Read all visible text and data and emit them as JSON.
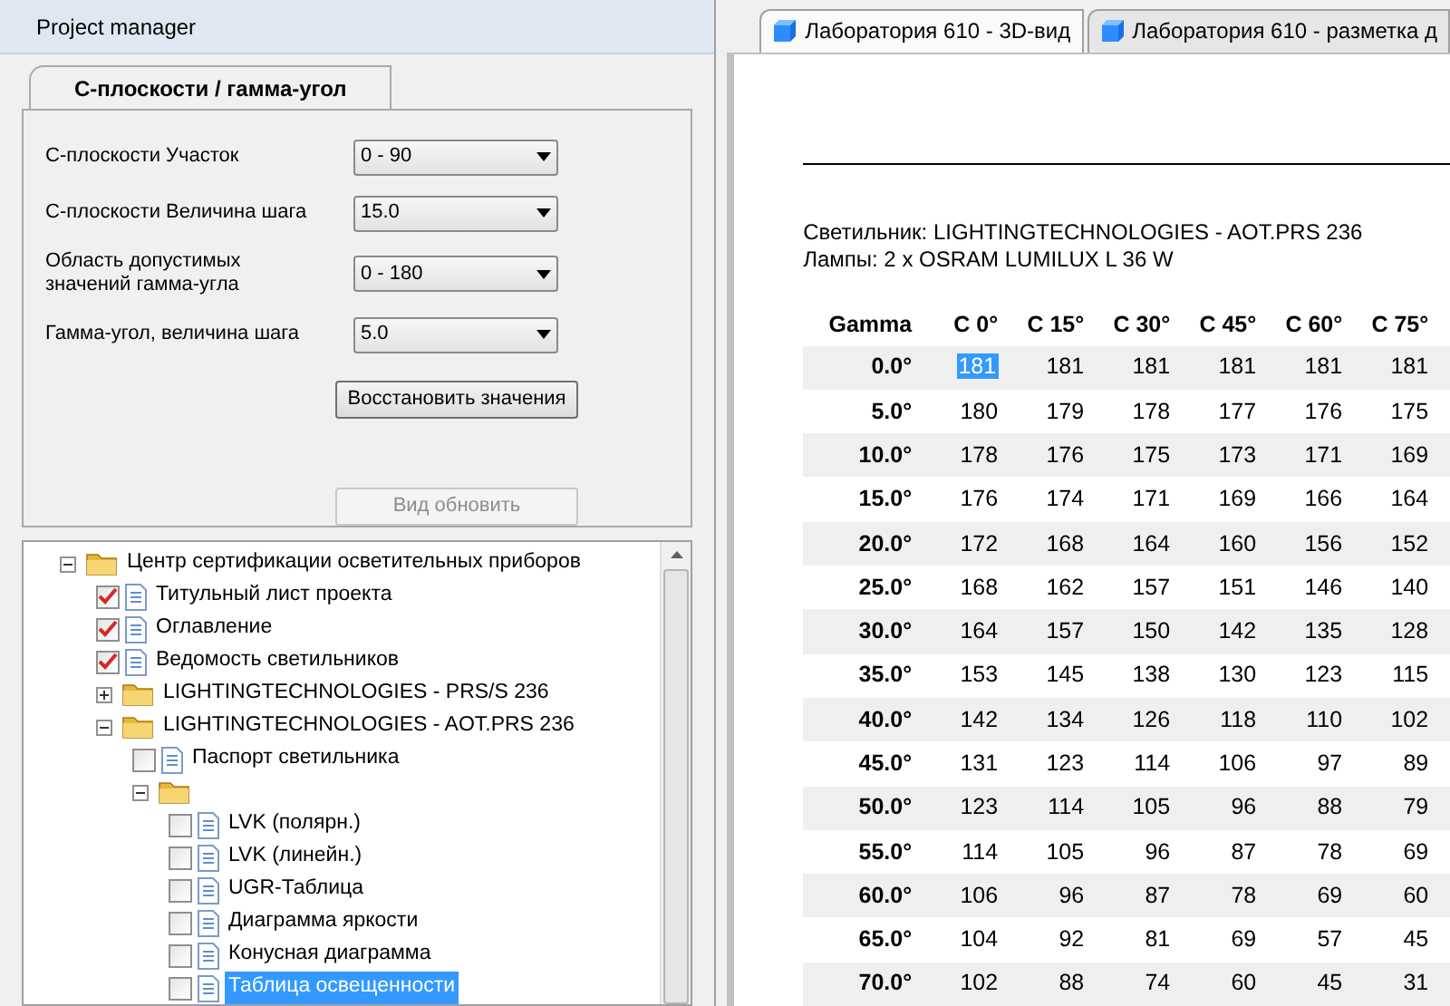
{
  "panel": {
    "title": "Project manager"
  },
  "settings_tabs": [
    {
      "label": "С-плоскости / гамма-угол",
      "selected": true
    }
  ],
  "fields": [
    {
      "label": "С-плоскости Участок",
      "value": "0 - 90"
    },
    {
      "label": "С-плоскости Величина шага",
      "value": "15.0"
    },
    {
      "label": "Область допустимых значений гамма-угла",
      "value": "0 - 180"
    },
    {
      "label": "Гамма-угол, величина шага",
      "value": "5.0"
    }
  ],
  "buttons": [
    {
      "label": "Восстановить значения",
      "disabled": false
    },
    {
      "label": "Вид обновить",
      "disabled": true
    }
  ],
  "tree": [
    {
      "kind": "folder",
      "label": "Центр сертификации осветительных приборов",
      "expanded": true,
      "selected": false,
      "children": [
        {
          "kind": "document",
          "label": "Титульный лист проекта",
          "checked": true,
          "selected": false
        },
        {
          "kind": "document",
          "label": "Оглавление",
          "checked": true,
          "selected": false
        },
        {
          "kind": "document",
          "label": "Ведомость светильников",
          "checked": true,
          "selected": false
        },
        {
          "kind": "folder",
          "label": "LIGHTINGTECHNOLOGIES - PRS/S 236",
          "expanded": false,
          "selected": false
        },
        {
          "kind": "folder",
          "label": "LIGHTINGTECHNOLOGIES - AOT.PRS 236",
          "expanded": true,
          "selected": false,
          "children": [
            {
              "kind": "document",
              "label": "Паспорт светильника",
              "checked": false,
              "selected": false
            },
            {
              "kind": "folder",
              "expanded": true,
              "children": [
                {
                  "kind": "document",
                  "label": "LVK (полярн.)",
                  "checked": false,
                  "selected": false
                },
                {
                  "kind": "document",
                  "label": "LVK (линейн.)",
                  "checked": false,
                  "selected": false
                },
                {
                  "kind": "document",
                  "label": "UGR-Таблица",
                  "checked": false,
                  "selected": false
                },
                {
                  "kind": "document",
                  "label": "Диаграмма яркости",
                  "checked": false,
                  "selected": false
                },
                {
                  "kind": "document",
                  "label": "Конусная диаграмма",
                  "checked": false,
                  "selected": false
                },
                {
                  "kind": "document",
                  "label": "Таблица освещенности",
                  "checked": false,
                  "selected": true
                }
              ]
            }
          ]
        }
      ]
    }
  ],
  "view_tabs": [
    {
      "label": "Лаборатория 610 - 3D-вид",
      "selected": true
    },
    {
      "label": "Лаборатория 610 - разметка д",
      "selected": false
    }
  ],
  "document": {
    "luminaire": "Светильник: LIGHTINGTECHNOLOGIES - AOT.PRS 236",
    "lamps": "Лампы: 2 x OSRAM LUMILUX L 36 W",
    "table": {
      "columns": [
        "Gamma",
        "C 0°",
        "C 15°",
        "C 30°",
        "C 45°",
        "C 60°",
        "C 75°"
      ],
      "rows": [
        {
          "cells": [
            {
              "text": "0.0°",
              "selected": false
            },
            {
              "text": "181",
              "selected": true
            },
            {
              "text": "181",
              "selected": false
            },
            {
              "text": "181",
              "selected": false
            },
            {
              "text": "181",
              "selected": false
            },
            {
              "text": "181",
              "selected": false
            },
            {
              "text": "181",
              "selected": false
            }
          ]
        },
        {
          "cells": [
            {
              "text": "5.0°",
              "selected": false
            },
            {
              "text": "180",
              "selected": false
            },
            {
              "text": "179",
              "selected": false
            },
            {
              "text": "178",
              "selected": false
            },
            {
              "text": "177",
              "selected": false
            },
            {
              "text": "176",
              "selected": false
            },
            {
              "text": "175",
              "selected": false
            }
          ]
        },
        {
          "cells": [
            {
              "text": "10.0°",
              "selected": false
            },
            {
              "text": "178",
              "selected": false
            },
            {
              "text": "176",
              "selected": false
            },
            {
              "text": "175",
              "selected": false
            },
            {
              "text": "173",
              "selected": false
            },
            {
              "text": "171",
              "selected": false
            },
            {
              "text": "169",
              "selected": false
            }
          ]
        },
        {
          "cells": [
            {
              "text": "15.0°",
              "selected": false
            },
            {
              "text": "176",
              "selected": false
            },
            {
              "text": "174",
              "selected": false
            },
            {
              "text": "171",
              "selected": false
            },
            {
              "text": "169",
              "selected": false
            },
            {
              "text": "166",
              "selected": false
            },
            {
              "text": "164",
              "selected": false
            }
          ]
        },
        {
          "cells": [
            {
              "text": "20.0°",
              "selected": false
            },
            {
              "text": "172",
              "selected": false
            },
            {
              "text": "168",
              "selected": false
            },
            {
              "text": "164",
              "selected": false
            },
            {
              "text": "160",
              "selected": false
            },
            {
              "text": "156",
              "selected": false
            },
            {
              "text": "152",
              "selected": false
            }
          ]
        },
        {
          "cells": [
            {
              "text": "25.0°",
              "selected": false
            },
            {
              "text": "168",
              "selected": false
            },
            {
              "text": "162",
              "selected": false
            },
            {
              "text": "157",
              "selected": false
            },
            {
              "text": "151",
              "selected": false
            },
            {
              "text": "146",
              "selected": false
            },
            {
              "text": "140",
              "selected": false
            }
          ]
        },
        {
          "cells": [
            {
              "text": "30.0°",
              "selected": false
            },
            {
              "text": "164",
              "selected": false
            },
            {
              "text": "157",
              "selected": false
            },
            {
              "text": "150",
              "selected": false
            },
            {
              "text": "142",
              "selected": false
            },
            {
              "text": "135",
              "selected": false
            },
            {
              "text": "128",
              "selected": false
            }
          ]
        },
        {
          "cells": [
            {
              "text": "35.0°",
              "selected": false
            },
            {
              "text": "153",
              "selected": false
            },
            {
              "text": "145",
              "selected": false
            },
            {
              "text": "138",
              "selected": false
            },
            {
              "text": "130",
              "selected": false
            },
            {
              "text": "123",
              "selected": false
            },
            {
              "text": "115",
              "selected": false
            }
          ]
        },
        {
          "cells": [
            {
              "text": "40.0°",
              "selected": false
            },
            {
              "text": "142",
              "selected": false
            },
            {
              "text": "134",
              "selected": false
            },
            {
              "text": "126",
              "selected": false
            },
            {
              "text": "118",
              "selected": false
            },
            {
              "text": "110",
              "selected": false
            },
            {
              "text": "102",
              "selected": false
            }
          ]
        },
        {
          "cells": [
            {
              "text": "45.0°",
              "selected": false
            },
            {
              "text": "131",
              "selected": false
            },
            {
              "text": "123",
              "selected": false
            },
            {
              "text": "114",
              "selected": false
            },
            {
              "text": "106",
              "selected": false
            },
            {
              "text": "97",
              "selected": false
            },
            {
              "text": "89",
              "selected": false
            }
          ]
        },
        {
          "cells": [
            {
              "text": "50.0°",
              "selected": false
            },
            {
              "text": "123",
              "selected": false
            },
            {
              "text": "114",
              "selected": false
            },
            {
              "text": "105",
              "selected": false
            },
            {
              "text": "96",
              "selected": false
            },
            {
              "text": "88",
              "selected": false
            },
            {
              "text": "79",
              "selected": false
            }
          ]
        },
        {
          "cells": [
            {
              "text": "55.0°",
              "selected": false
            },
            {
              "text": "114",
              "selected": false
            },
            {
              "text": "105",
              "selected": false
            },
            {
              "text": "96",
              "selected": false
            },
            {
              "text": "87",
              "selected": false
            },
            {
              "text": "78",
              "selected": false
            },
            {
              "text": "69",
              "selected": false
            }
          ]
        },
        {
          "cells": [
            {
              "text": "60.0°",
              "selected": false
            },
            {
              "text": "106",
              "selected": false
            },
            {
              "text": "96",
              "selected": false
            },
            {
              "text": "87",
              "selected": false
            },
            {
              "text": "78",
              "selected": false
            },
            {
              "text": "69",
              "selected": false
            },
            {
              "text": "60",
              "selected": false
            }
          ]
        },
        {
          "cells": [
            {
              "text": "65.0°",
              "selected": false
            },
            {
              "text": "104",
              "selected": false
            },
            {
              "text": "92",
              "selected": false
            },
            {
              "text": "81",
              "selected": false
            },
            {
              "text": "69",
              "selected": false
            },
            {
              "text": "57",
              "selected": false
            },
            {
              "text": "45",
              "selected": false
            }
          ]
        },
        {
          "cells": [
            {
              "text": "70.0°",
              "selected": false
            },
            {
              "text": "102",
              "selected": false
            },
            {
              "text": "88",
              "selected": false
            },
            {
              "text": "74",
              "selected": false
            },
            {
              "text": "60",
              "selected": false
            },
            {
              "text": "45",
              "selected": false
            },
            {
              "text": "31",
              "selected": false
            }
          ]
        }
      ]
    }
  }
}
